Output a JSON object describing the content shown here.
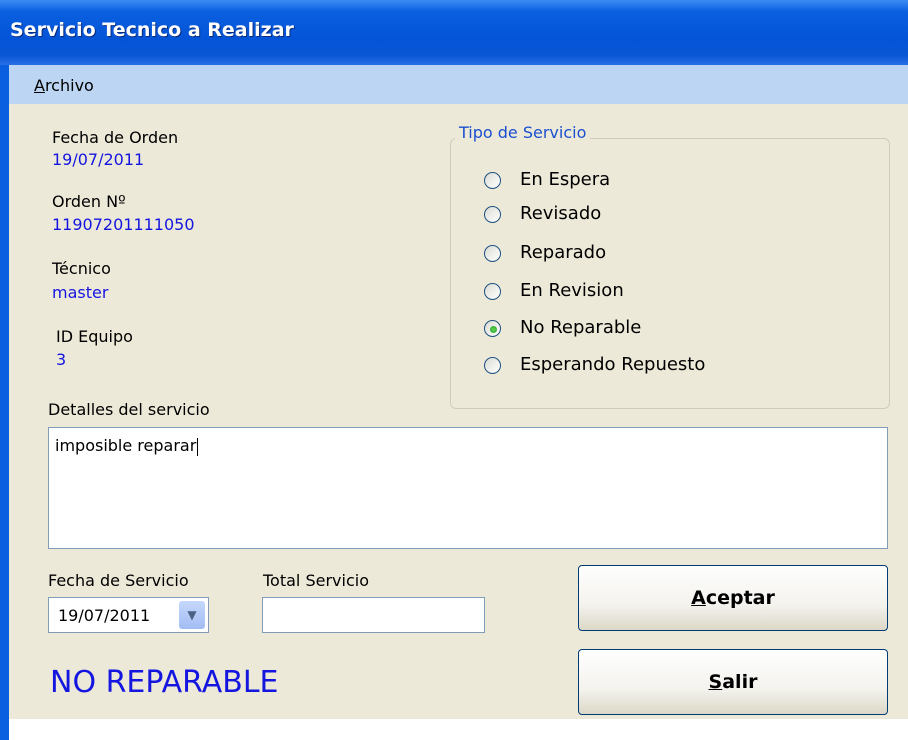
{
  "window": {
    "title": "Servicio Tecnico a Realizar"
  },
  "menu": {
    "items": [
      {
        "first": "A",
        "rest": "rchivo"
      }
    ]
  },
  "order": {
    "fecha_label": "Fecha de Orden",
    "fecha_value": "19/07/2011",
    "orden_label": "Orden Nº",
    "orden_value": "11907201111050",
    "tecnico_label": "Técnico",
    "tecnico_value": "master",
    "equipo_label": "ID Equipo",
    "equipo_value": "3"
  },
  "tipo_servicio": {
    "title": "Tipo de Servicio",
    "options": [
      {
        "label": "En Espera",
        "selected": false
      },
      {
        "label": "Revisado",
        "selected": false
      },
      {
        "label": "Reparado",
        "selected": false
      },
      {
        "label": "En Revision",
        "selected": false
      },
      {
        "label": "No Reparable",
        "selected": true
      },
      {
        "label": "Esperando Repuesto",
        "selected": false
      }
    ]
  },
  "detalles": {
    "label": "Detalles del servicio",
    "value": "imposible reparar"
  },
  "fecha_servicio": {
    "label": "Fecha de Servicio",
    "value": "19/07/2011"
  },
  "total_servicio": {
    "label": "Total Servicio",
    "value": ""
  },
  "buttons": {
    "aceptar": {
      "first": "A",
      "rest": "ceptar"
    },
    "salir": {
      "first": "S",
      "rest": "alir"
    }
  },
  "status": "NO REPARABLE",
  "colors": {
    "title_bar": "#0454d8",
    "menu_bar": "#bcd5f3",
    "value_text": "#1515e0",
    "group_title": "#1a4fd0",
    "window_bg": "#ece9d8"
  }
}
